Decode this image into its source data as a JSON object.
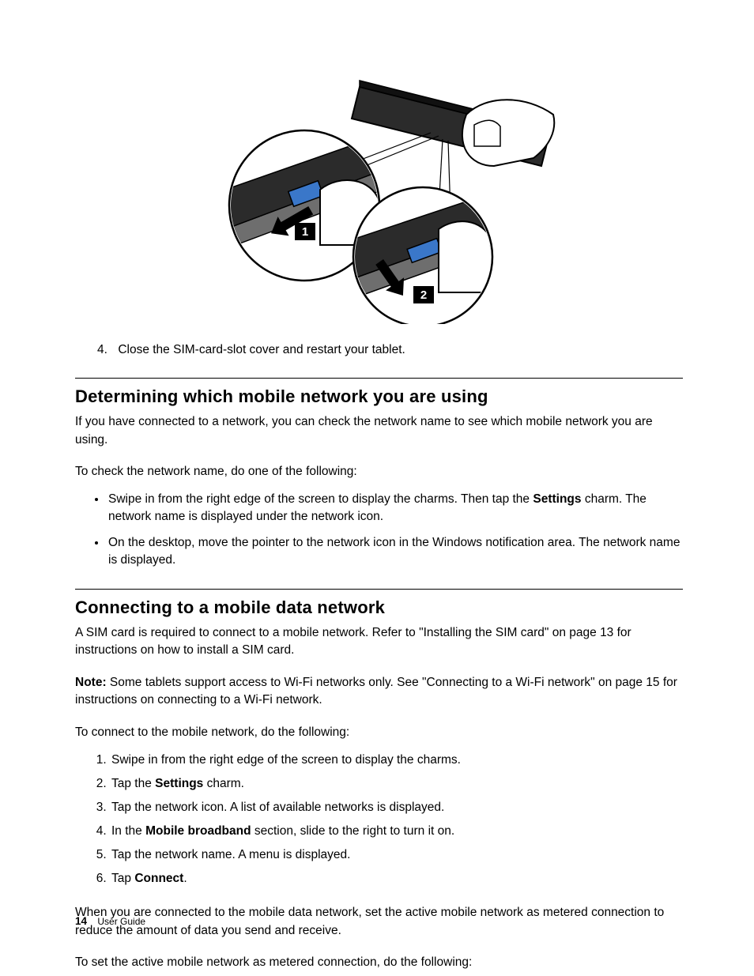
{
  "figure": {
    "callout1": "1",
    "callout2": "2"
  },
  "step4": {
    "num": "4.",
    "text": "Close the SIM-card-slot cover and restart your tablet."
  },
  "section1": {
    "title": "Determining which mobile network you are using",
    "intro": "If you have connected to a network, you can check the network name to see which mobile network you are using.",
    "lead": "To check the network name, do one of the following:",
    "bullets": [
      {
        "pre": "Swipe in from the right edge of the screen to display the charms.  Then tap the ",
        "bold": "Settings",
        "post": " charm.  The network name is displayed under the network icon."
      },
      {
        "pre": "On the desktop, move the pointer to the network icon in the Windows notification area.  The network name is displayed.",
        "bold": "",
        "post": ""
      }
    ]
  },
  "section2": {
    "title": "Connecting to a mobile data network",
    "intro": "A SIM card is required to connect to a mobile network.  Refer to \"Installing the SIM card\" on page 13 for instructions on how to install a SIM card.",
    "note_label": "Note:",
    "note_text": " Some tablets support access to Wi-Fi networks only.  See \"Connecting to a Wi-Fi network\" on page 15 for instructions on connecting to a Wi-Fi network.",
    "lead": "To connect to the mobile network, do the following:",
    "steps": [
      {
        "pre": "Swipe in from the right edge of the screen to display the charms.",
        "bold": "",
        "post": ""
      },
      {
        "pre": "Tap the ",
        "bold": "Settings",
        "post": " charm."
      },
      {
        "pre": "Tap the network icon.  A list of available networks is displayed.",
        "bold": "",
        "post": ""
      },
      {
        "pre": "In the ",
        "bold": "Mobile broadband",
        "post": " section, slide to the right to turn it on."
      },
      {
        "pre": "Tap the network name.  A menu is displayed.",
        "bold": "",
        "post": ""
      },
      {
        "pre": "Tap ",
        "bold": "Connect",
        "post": "."
      }
    ],
    "after1": "When you are connected to the mobile data network, set the active mobile network as metered connection to reduce the amount of data you send and receive.",
    "after2": "To set the active mobile network as metered connection, do the following:"
  },
  "footer": {
    "page": "14",
    "label": "User Guide"
  }
}
